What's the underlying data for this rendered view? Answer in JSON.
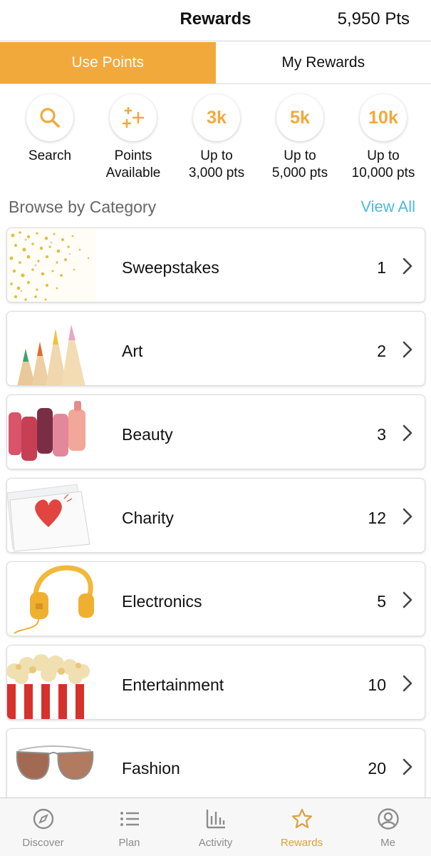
{
  "header": {
    "title": "Rewards",
    "points": "5,950 Pts"
  },
  "tabs": [
    {
      "label": "Use Points",
      "active": true
    },
    {
      "label": "My Rewards",
      "active": false
    }
  ],
  "filters": [
    {
      "icon": "search-icon",
      "circle_text": "",
      "label_lines": [
        "Search"
      ]
    },
    {
      "icon": "sparkle-plus-icon",
      "circle_text": "",
      "label_lines": [
        "Points",
        "Available"
      ]
    },
    {
      "icon": "",
      "circle_text": "3k",
      "label_lines": [
        "Up to",
        "3,000 pts"
      ]
    },
    {
      "icon": "",
      "circle_text": "5k",
      "label_lines": [
        "Up to",
        "5,000 pts"
      ]
    },
    {
      "icon": "",
      "circle_text": "10k",
      "label_lines": [
        "Up to",
        "10,000 pts"
      ]
    }
  ],
  "section": {
    "title": "Browse by Category",
    "view_all": "View All"
  },
  "categories": [
    {
      "name": "Sweepstakes",
      "count": "1",
      "image": "gold-confetti-image"
    },
    {
      "name": "Art",
      "count": "2",
      "image": "colored-pencils-image"
    },
    {
      "name": "Beauty",
      "count": "3",
      "image": "lipsticks-image"
    },
    {
      "name": "Charity",
      "count": "12",
      "image": "heart-card-image"
    },
    {
      "name": "Electronics",
      "count": "5",
      "image": "headphones-image"
    },
    {
      "name": "Entertainment",
      "count": "10",
      "image": "popcorn-image"
    },
    {
      "name": "Fashion",
      "count": "20",
      "image": "sunglasses-image"
    }
  ],
  "tabbar": [
    {
      "label": "Discover",
      "icon": "compass-icon",
      "active": false
    },
    {
      "label": "Plan",
      "icon": "list-icon",
      "active": false
    },
    {
      "label": "Activity",
      "icon": "bar-chart-icon",
      "active": false
    },
    {
      "label": "Rewards",
      "icon": "star-icon",
      "active": true
    },
    {
      "label": "Me",
      "icon": "user-circle-icon",
      "active": false
    }
  ],
  "colors": {
    "accent": "#f2a93b",
    "link": "#4db8e2",
    "active_tab_label": "#e0a03a"
  }
}
